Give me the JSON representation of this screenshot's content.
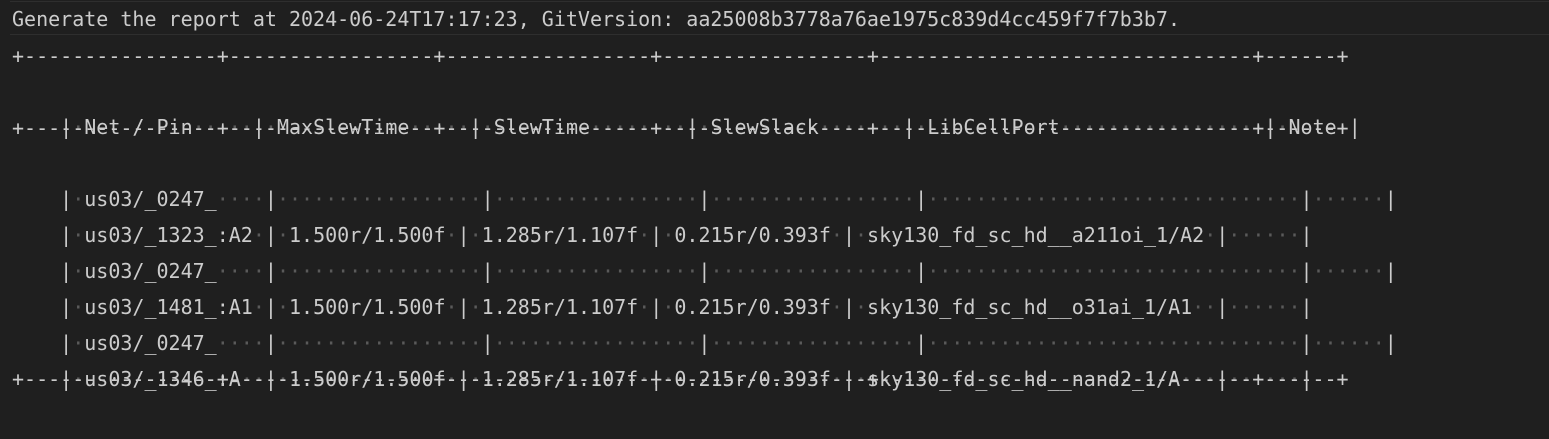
{
  "header_line": "Generate the report at 2024-06-24T17:17:23, GitVersion: aa25008b3778a76ae1975c839d4cc459f7f7b3b7.",
  "table": {
    "separator": "+----------------+-----------------+-----------------+-----------------+-------------------------------+------+",
    "columns": [
      "Net / Pin",
      "MaxSlewTime",
      "SlewTime",
      "SlewSlack",
      "LibCellPort",
      "Note"
    ],
    "rows": [
      [
        "us03/_0247_",
        "",
        "",
        "",
        "",
        ""
      ],
      [
        "us03/_1323_:A2",
        "1.500r/1.500f",
        "1.285r/1.107f",
        "0.215r/0.393f",
        "sky130_fd_sc_hd__a211oi_1/A2",
        ""
      ],
      [
        "us03/_0247_",
        "",
        "",
        "",
        "",
        ""
      ],
      [
        "us03/_1481_:A1",
        "1.500r/1.500f",
        "1.285r/1.107f",
        "0.215r/0.393f",
        "sky130_fd_sc_hd__o31ai_1/A1",
        ""
      ],
      [
        "us03/_0247_",
        "",
        "",
        "",
        "",
        ""
      ],
      [
        "us03/_1346_:A",
        "1.500r/1.500f",
        "1.285r/1.107f",
        "0.215r/0.393f",
        "sky130_fd_sc_hd__nand2_1/A",
        ""
      ]
    ]
  },
  "colors": {
    "background": "#1f1f1f",
    "text": "#cccccc",
    "whitespace_dots": "#5a5a5a"
  }
}
